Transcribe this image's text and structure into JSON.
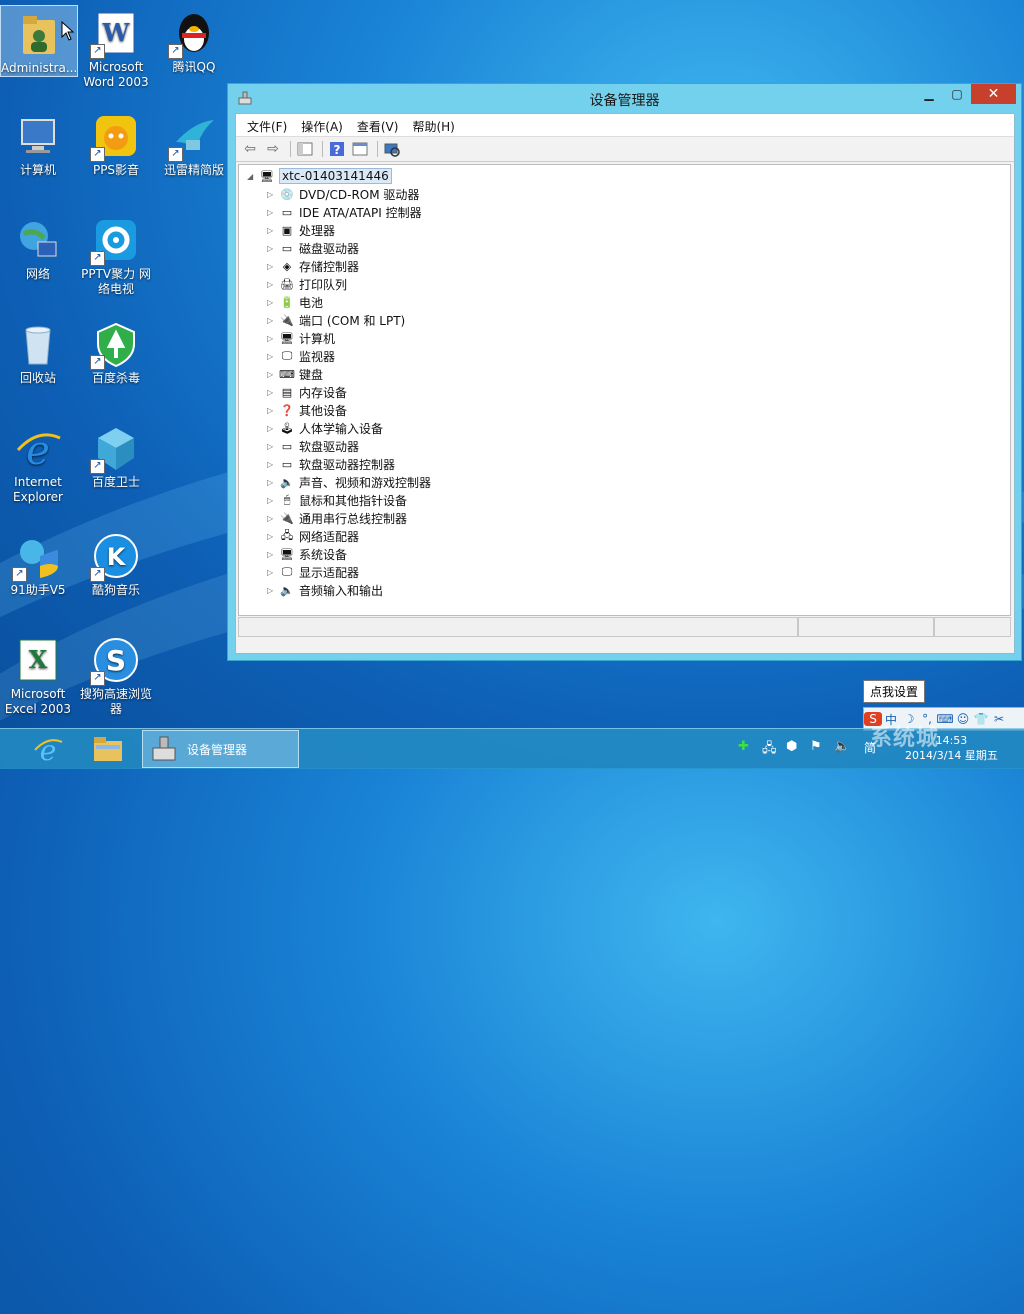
{
  "desktop": {
    "icons": [
      {
        "label": "Administra..."
      },
      {
        "label": "Microsoft Word 2003"
      },
      {
        "label": "腾讯QQ"
      },
      {
        "label": "计算机"
      },
      {
        "label": "PPS影音"
      },
      {
        "label": "迅雷精简版"
      },
      {
        "label": "网络"
      },
      {
        "label": "PPTV聚力 网络电视"
      },
      {
        "label": "回收站"
      },
      {
        "label": "百度杀毒"
      },
      {
        "label": "Internet Explorer"
      },
      {
        "label": "百度卫士"
      },
      {
        "label": "91助手V5"
      },
      {
        "label": "酷狗音乐"
      },
      {
        "label": "Microsoft Excel 2003"
      },
      {
        "label": "搜狗高速浏览器"
      }
    ]
  },
  "window": {
    "title": "设备管理器",
    "menu": [
      "文件(F)",
      "操作(A)",
      "查看(V)",
      "帮助(H)"
    ],
    "tree": {
      "root": "xtc-01403141446",
      "children": [
        "DVD/CD-ROM 驱动器",
        "IDE ATA/ATAPI 控制器",
        "处理器",
        "磁盘驱动器",
        "存储控制器",
        "打印队列",
        "电池",
        "端口 (COM 和 LPT)",
        "计算机",
        "监视器",
        "键盘",
        "内存设备",
        "其他设备",
        "人体学输入设备",
        "软盘驱动器",
        "软盘驱动器控制器",
        "声音、视频和游戏控制器",
        "鼠标和其他指针设备",
        "通用串行总线控制器",
        "网络适配器",
        "系统设备",
        "显示适配器",
        "音频输入和输出"
      ]
    }
  },
  "tooltip": "点我设置",
  "taskbar": {
    "active_item": "设备管理器",
    "ime": "简",
    "time": "14:53",
    "date": "2014/3/14 星期五"
  },
  "watermark": "系统城"
}
